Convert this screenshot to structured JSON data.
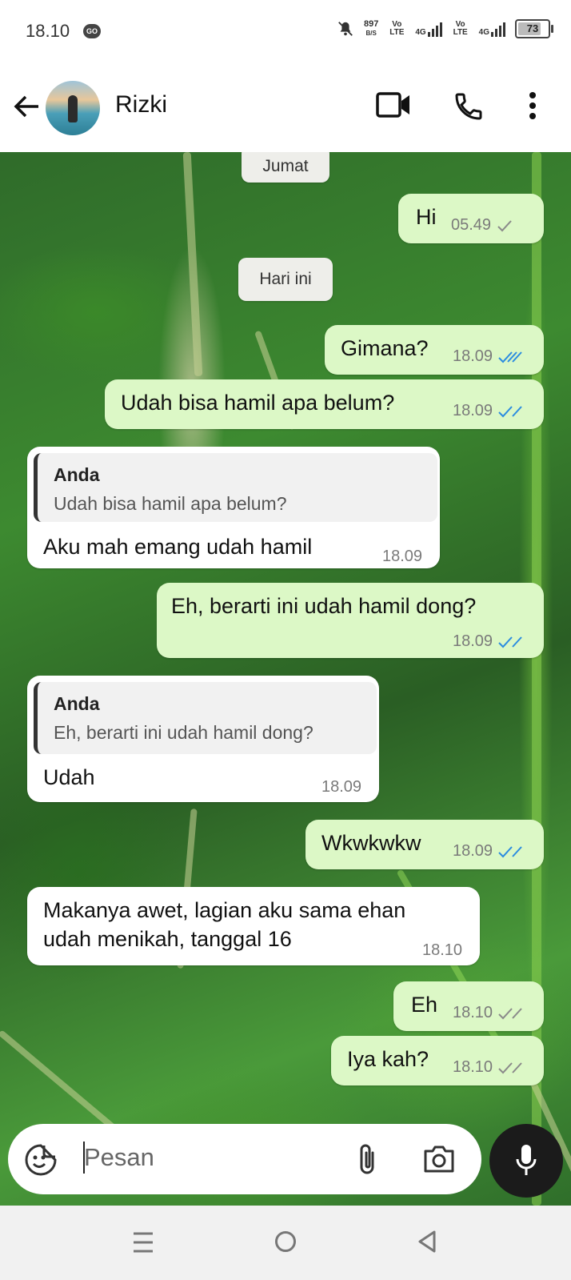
{
  "status_bar": {
    "time": "18.10",
    "app_badge": "GO",
    "net_speed_value": "897",
    "net_speed_unit": "B/S",
    "sim1": "Vo LTE",
    "sim1_net": "4G",
    "sim2": "Vo LTE",
    "sim2_net": "4G",
    "battery": "73"
  },
  "header": {
    "contact_name": "Rizki",
    "icons": [
      "back-arrow-icon",
      "video-call-icon",
      "phone-icon",
      "more-vert-icon"
    ]
  },
  "chat": {
    "date_chips": [
      "Jumat",
      "Hari ini"
    ],
    "messages": [
      {
        "dir": "out",
        "text": "Hi",
        "time": "05.49",
        "status": "sent"
      },
      {
        "dir": "out",
        "text": "Gimana?",
        "time": "18.09",
        "status": "read"
      },
      {
        "dir": "out",
        "text": "Udah bisa hamil apa belum?",
        "time": "18.09",
        "status": "read"
      },
      {
        "dir": "in",
        "quote_author": "Anda",
        "quote_text": "Udah bisa hamil apa belum?",
        "text": "Aku mah emang udah hamil",
        "time": "18.09"
      },
      {
        "dir": "out",
        "text": "Eh, berarti ini udah hamil dong?",
        "time": "18.09",
        "status": "read"
      },
      {
        "dir": "in",
        "quote_author": "Anda",
        "quote_text": "Eh, berarti ini udah hamil dong?",
        "text": "Udah",
        "time": "18.09"
      },
      {
        "dir": "out",
        "text": "Wkwkwkw",
        "time": "18.09",
        "status": "read"
      },
      {
        "dir": "in",
        "text_line1": "Makanya awet, lagian aku sama ehan",
        "text_line2": "udah menikah, tanggal 16",
        "time": "18.10"
      },
      {
        "dir": "out",
        "text": "Eh",
        "time": "18.10",
        "status": "delivered"
      },
      {
        "dir": "out",
        "text": "Iya kah?",
        "time": "18.10",
        "status": "delivered"
      }
    ]
  },
  "composer": {
    "placeholder": "Pesan",
    "icons": [
      "sticker-icon",
      "attach-icon",
      "camera-icon",
      "mic-icon"
    ]
  },
  "nav_bar": {
    "icons": [
      "recents-icon",
      "home-icon",
      "back-icon"
    ]
  },
  "colors": {
    "outgoing_bubble": "#dcf8c6",
    "incoming_bubble": "#ffffff",
    "read_tick": "#2b8ce0",
    "unread_tick": "#8a8a8a"
  }
}
